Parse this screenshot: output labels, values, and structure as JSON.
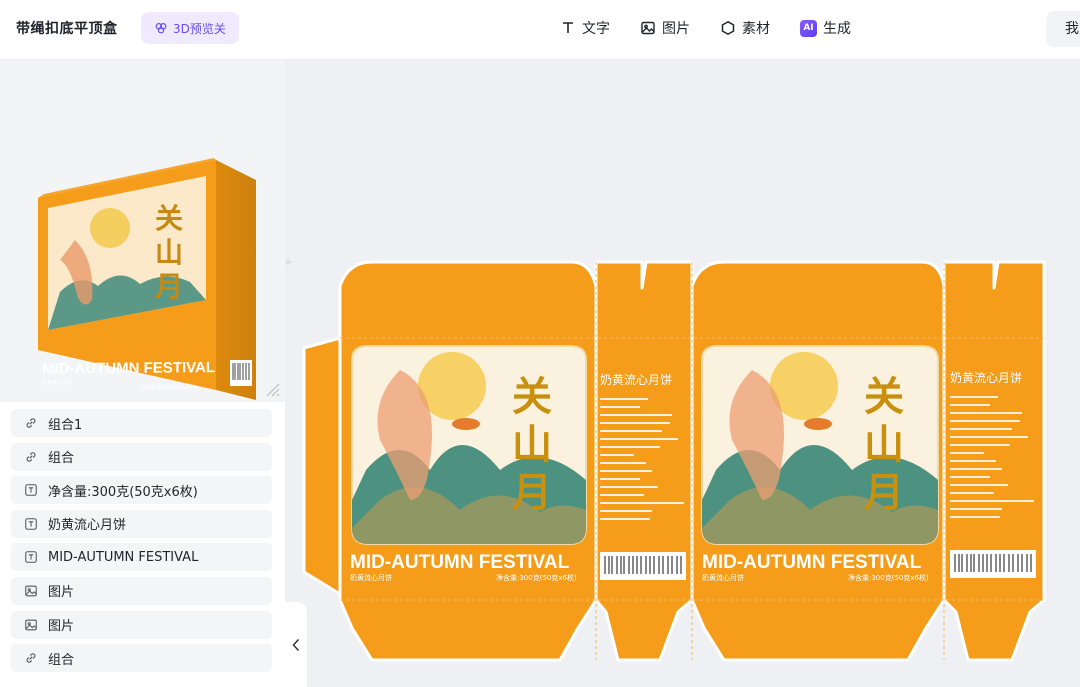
{
  "header": {
    "doc_title": "带绳扣底平顶盒",
    "preview_3d_toggle": "3D预览关",
    "tools": [
      {
        "label": "文字",
        "icon": "text-icon"
      },
      {
        "label": "图片",
        "icon": "image-icon"
      },
      {
        "label": "素材",
        "icon": "hexagon-icon"
      },
      {
        "label": "生成",
        "icon": "ai-icon"
      }
    ],
    "ai_badge": "AI",
    "right_button_label": "我"
  },
  "layers": [
    {
      "label": "组合1",
      "icon": "link-icon"
    },
    {
      "label": "组合",
      "icon": "link-icon"
    },
    {
      "label": "净含量:300克(50克x6枚)",
      "icon": "text-box-icon"
    },
    {
      "label": "奶黄流心月饼",
      "icon": "text-box-icon"
    },
    {
      "label": "MID-AUTUMN FESTIVAL",
      "icon": "text-box-icon"
    },
    {
      "label": "图片",
      "icon": "image-icon"
    },
    {
      "label": "图片",
      "icon": "image-icon"
    },
    {
      "label": "组合",
      "icon": "link-icon"
    }
  ],
  "artwork": {
    "calligraphy": "关山月",
    "banner": "MID-AUTUMN FESTIVAL",
    "product_name": "奶黄流心月饼",
    "net_content": "净含量:300克(50克x6枚)",
    "side_title": "奶黄流心月饼"
  },
  "colors": {
    "box_orange": "#f59d1a",
    "accent_purple": "#6a4cf5",
    "canvas_bg": "#eff0f3"
  }
}
